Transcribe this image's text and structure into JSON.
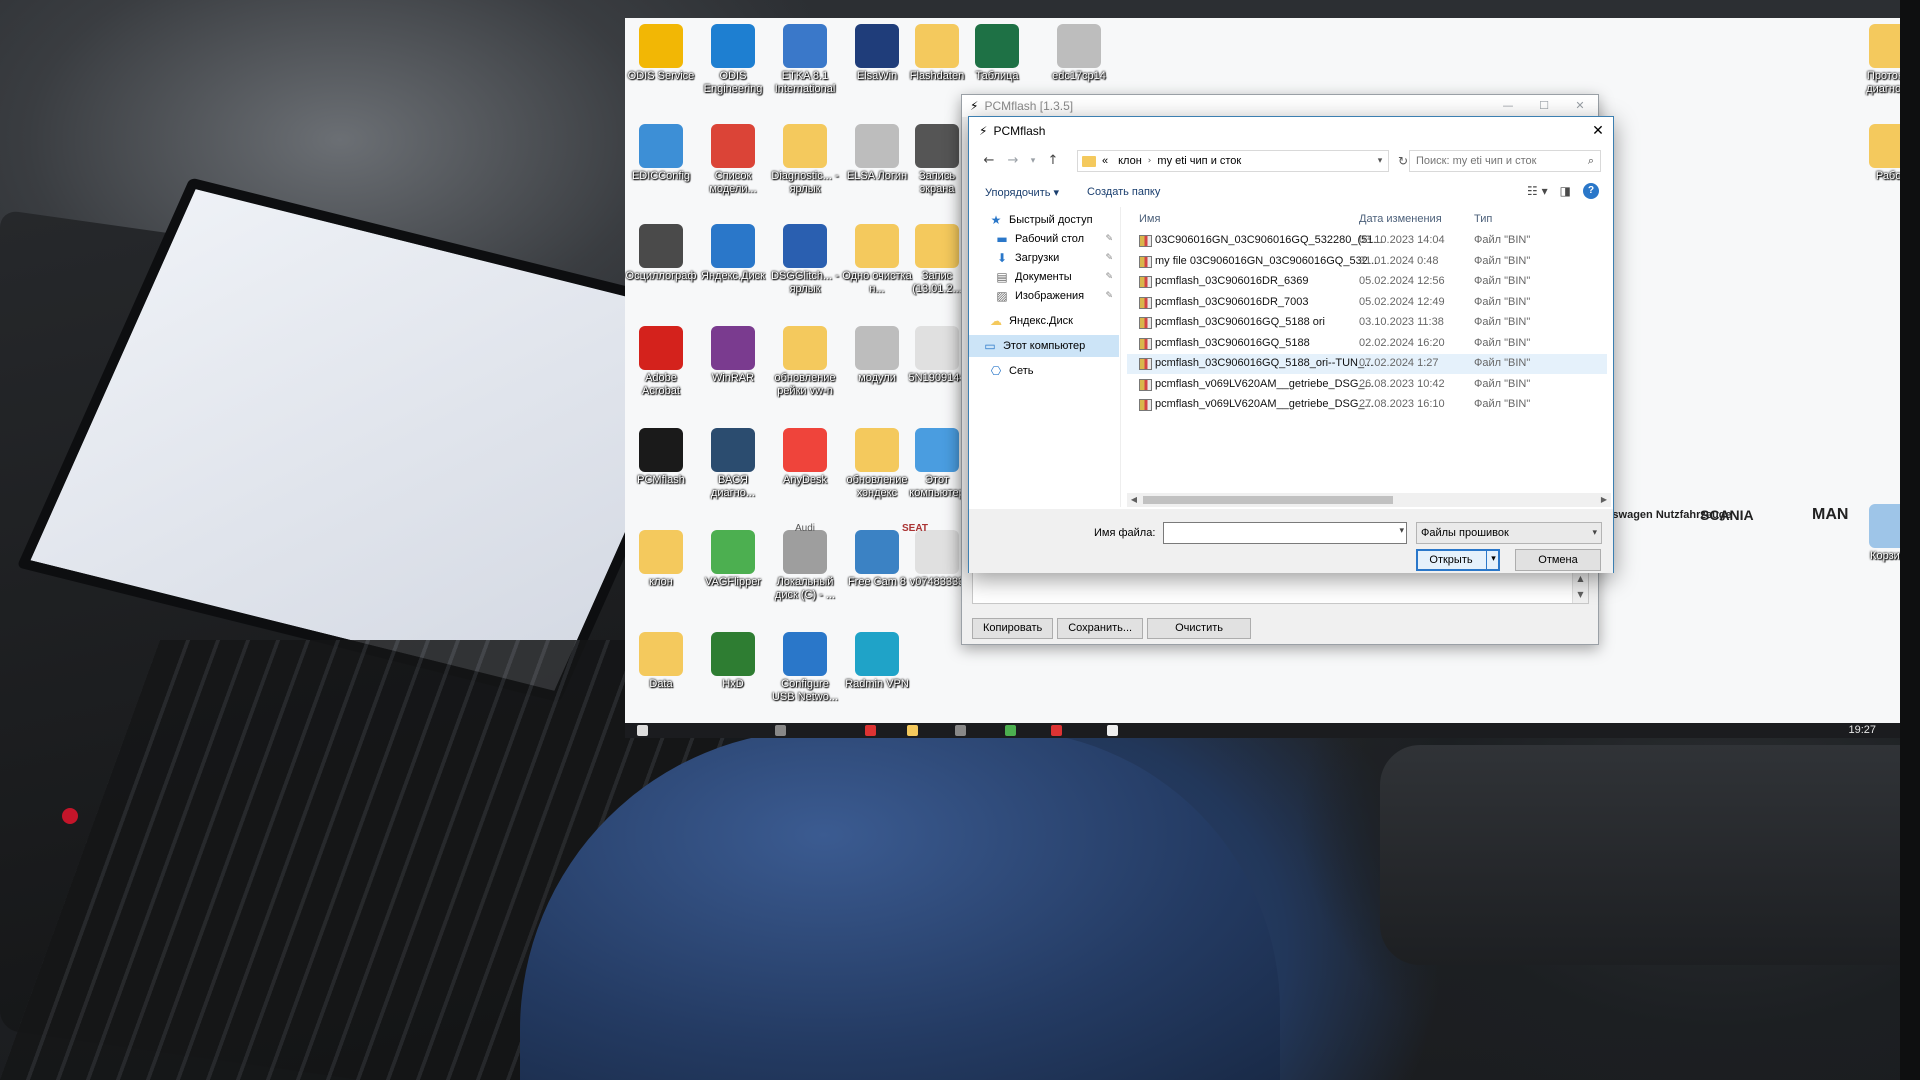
{
  "desktop": {
    "icons": [
      {
        "label": "ODIS Service",
        "icon": "odis-service-icon",
        "color": "#f2b705"
      },
      {
        "label": "ODIS Engineering",
        "icon": "odis-engineering-icon",
        "color": "#1e7fd1"
      },
      {
        "label": "ETKA 8.1 International",
        "icon": "etka-globe-icon",
        "color": "#3a78c9"
      },
      {
        "label": "ElsaWin",
        "icon": "elsawin-icon",
        "color": "#1f3d7a"
      },
      {
        "label": "Flashdaten",
        "icon": "folder-icon",
        "color": "#f4c95d"
      },
      {
        "label": "Таблица",
        "icon": "excel-file-icon",
        "color": "#1e7145"
      },
      {
        "label": "edc17cp14",
        "icon": "text-file-icon",
        "color": "#bdbdbd"
      },
      {
        "label": "EDICConfig",
        "icon": "edic-icon",
        "color": "#3d8fd6"
      },
      {
        "label": "Cписок модели...",
        "icon": "chrome-icon",
        "color": "#db4437"
      },
      {
        "label": "Diagnostic... - ярлык",
        "icon": "diagnostic-folder-icon",
        "color": "#f4c95d"
      },
      {
        "label": "ELSA Логин",
        "icon": "text-file-icon",
        "color": "#bdbdbd"
      },
      {
        "label": "Запись экрана",
        "icon": "screen-record-icon",
        "color": "#555"
      },
      {
        "label": "Осциллограф",
        "icon": "oscilloscope-icon",
        "color": "#4a4a4a"
      },
      {
        "label": "Яндекс.Диск",
        "icon": "yandex-disk-icon",
        "color": "#2a77c9"
      },
      {
        "label": "DSGGlitch... - ярлык",
        "icon": "gear-settings-icon",
        "color": "#2a5fb0"
      },
      {
        "label": "Одно очистка н...",
        "icon": "folder-icon",
        "color": "#f4c95d"
      },
      {
        "label": "Запис (13.01.2...",
        "icon": "folder-icon",
        "color": "#f4c95d"
      },
      {
        "label": "Adobe Acrobat",
        "icon": "adobe-acrobat-icon",
        "color": "#d4221c"
      },
      {
        "label": "WinRAR",
        "icon": "winrar-icon",
        "color": "#7a3b8f"
      },
      {
        "label": "обновление рейки vw-n",
        "icon": "folder-icon",
        "color": "#f4c95d"
      },
      {
        "label": "модули",
        "icon": "text-file-icon",
        "color": "#bdbdbd"
      },
      {
        "label": "5N1909144",
        "icon": "blank-file-icon",
        "color": "#e0e0e0"
      },
      {
        "label": "PCMflash",
        "icon": "pcmflash-bolt-icon",
        "color": "#1a1a1a"
      },
      {
        "label": "ВАСЯ диагно...",
        "icon": "vasya-diagnostics-icon",
        "color": "#2b4c6f"
      },
      {
        "label": "AnyDesk",
        "icon": "anydesk-icon",
        "color": "#ef443b"
      },
      {
        "label": "обновление хэндекс",
        "icon": "folder-icon",
        "color": "#f4c95d"
      },
      {
        "label": "Этот компьютер",
        "icon": "this-pc-icon",
        "color": "#4a9de0"
      },
      {
        "label": "клон",
        "icon": "folder-icon",
        "color": "#f4c95d"
      },
      {
        "label": "VAGFlipper",
        "icon": "vag-flipper-icon",
        "color": "#4caf50"
      },
      {
        "label": "Локальный диск (C) - ...",
        "icon": "local-disk-icon",
        "color": "#9e9e9e"
      },
      {
        "label": "Free Cam 8",
        "icon": "free-cam-icon",
        "color": "#3b82c4"
      },
      {
        "label": "v07483333",
        "icon": "blank-file-icon",
        "color": "#e0e0e0"
      },
      {
        "label": "Data",
        "icon": "folder-icon",
        "color": "#f4c95d"
      },
      {
        "label": "HxD",
        "icon": "hxd-icon",
        "color": "#2e7d32"
      },
      {
        "label": "Configure USB Netwo...",
        "icon": "usb-network-icon",
        "color": "#2a77c9"
      },
      {
        "label": "Radmin VPN",
        "icon": "radmin-vpn-icon",
        "color": "#1fa3c8"
      },
      {
        "label": "Протокол диагнос...",
        "icon": "folder-icon",
        "color": "#f4c95d"
      },
      {
        "label": "Работ",
        "icon": "folder-icon",
        "color": "#f4c95d"
      },
      {
        "label": "Корзина",
        "icon": "recycle-bin-icon",
        "color": "#9ec5e8"
      }
    ],
    "brand_logos": [
      "Volkswagen Nutzfahrzeuge",
      "SCANIA",
      "MAN"
    ],
    "vw_emblem_text": "Audi",
    "seat_text": "SEAT"
  },
  "taskbar": {
    "clock": "19:27"
  },
  "pcm_window": {
    "title": "PCMflash [1.3.5]",
    "buttons": {
      "copy": "Копировать",
      "save": "Сохранить...",
      "clear": "Очистить"
    }
  },
  "dialog": {
    "title": "PCMflash",
    "breadcrumb": [
      "«",
      "клон",
      "my eti чип и сток"
    ],
    "search_placeholder": "Поиск: my eti чип и сток",
    "toolbar": {
      "organize": "Упорядочить ▾",
      "new_folder": "Создать папку"
    },
    "nav_pane": [
      {
        "label": "Быстрый доступ",
        "icon": "star-icon",
        "pinned": false
      },
      {
        "label": "Рабочий стол",
        "icon": "desktop-icon",
        "pinned": true
      },
      {
        "label": "Загрузки",
        "icon": "downloads-icon",
        "pinned": true
      },
      {
        "label": "Документы",
        "icon": "documents-icon",
        "pinned": true
      },
      {
        "label": "Изображения",
        "icon": "pictures-icon",
        "pinned": true
      },
      {
        "label": "Яндекс.Диск",
        "icon": "yandex-disk-icon",
        "pinned": false
      },
      {
        "label": "Этот компьютер",
        "icon": "this-pc-icon",
        "pinned": false
      },
      {
        "label": "Сеть",
        "icon": "network-icon",
        "pinned": false
      }
    ],
    "columns": {
      "name": "Имя",
      "date": "Дата изменения",
      "type": "Тип"
    },
    "files": [
      {
        "name": "03C906016GN_03C906016GQ_532280_(51...",
        "date": "03.10.2023 14:04",
        "type": "Файл \"BIN\""
      },
      {
        "name": "my file 03C906016GN_03C906016GQ_532...",
        "date": "31.01.2024 0:48",
        "type": "Файл \"BIN\""
      },
      {
        "name": "pcmflash_03C906016DR_6369",
        "date": "05.02.2024 12:56",
        "type": "Файл \"BIN\""
      },
      {
        "name": "pcmflash_03C906016DR_7003",
        "date": "05.02.2024 12:49",
        "type": "Файл \"BIN\""
      },
      {
        "name": "pcmflash_03C906016GQ_5188 ori",
        "date": "03.10.2023 11:38",
        "type": "Файл \"BIN\""
      },
      {
        "name": "pcmflash_03C906016GQ_5188",
        "date": "02.02.2024 16:20",
        "type": "Файл \"BIN\""
      },
      {
        "name": "pcmflash_03C906016GQ_5188_ori--TUN_...",
        "date": "07.02.2024 1:27",
        "type": "Файл \"BIN\""
      },
      {
        "name": "pcmflash_v069LV620AM__getriebe_DSG_...",
        "date": "26.08.2023 10:42",
        "type": "Файл \"BIN\""
      },
      {
        "name": "pcmflash_v069LV620AM__getriebe_DSG_...",
        "date": "27.08.2023 16:10",
        "type": "Файл \"BIN\""
      }
    ],
    "highlighted_file_index": 6,
    "filename_label": "Имя файла:",
    "filename_value": "",
    "filetype_selected": "Файлы прошивок",
    "open_button": "Открыть",
    "cancel_button": "Отмена"
  },
  "colors": {
    "accent": "#2a77c9",
    "selection": "#cce4f7",
    "hover_row": "#e5f1fb"
  }
}
